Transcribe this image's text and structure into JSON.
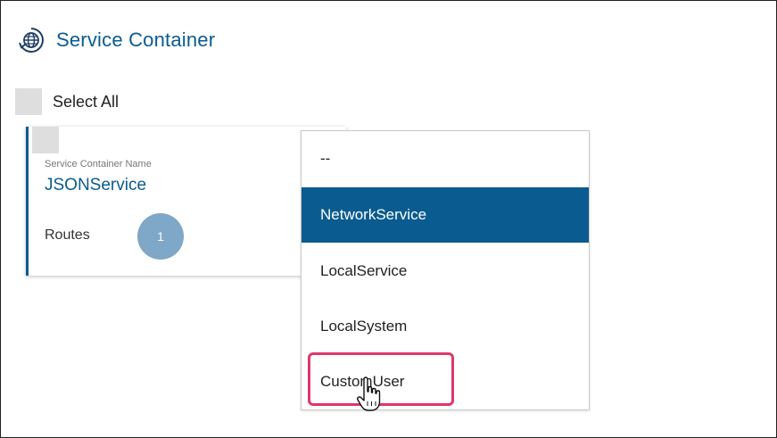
{
  "header": {
    "title": "Service Container",
    "icon": "globe-refresh-icon",
    "accent_color": "#0a5b8f"
  },
  "select_all": {
    "label": "Select All",
    "checked": false
  },
  "card": {
    "caption": "Service Container Name",
    "name": "JSONService",
    "routes_label": "Routes",
    "routes_count": "1",
    "badge_color": "#7fa7c7"
  },
  "dropdown": {
    "options": [
      "--",
      "NetworkService",
      "LocalService",
      "LocalSystem",
      "CustomUser"
    ],
    "selected": "NetworkService",
    "selected_color": "#0a5b8f",
    "hovered": "CustomUser",
    "highlight_color": "#e0376a"
  },
  "cursor": {
    "icon": "hand-pointer-icon"
  }
}
